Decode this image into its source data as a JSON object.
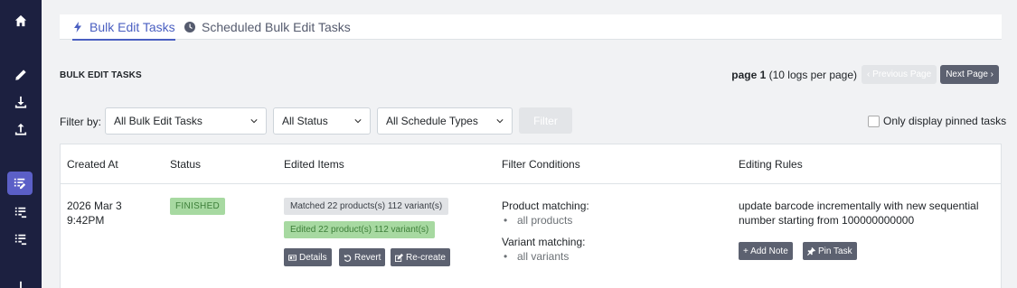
{
  "tabs": [
    {
      "label": "Bulk Edit Tasks",
      "active": true,
      "icon": "bolt-icon"
    },
    {
      "label": "Scheduled Bulk Edit Tasks",
      "active": false,
      "icon": "clock-icon"
    }
  ],
  "section_title": "BULK EDIT TASKS",
  "pager": {
    "page_label": "page 1",
    "per_page": "(10 logs per page)",
    "prev": "‹ Previous Page",
    "next": "Next Page ›"
  },
  "filters": {
    "label": "Filter by:",
    "task_type": "All Bulk Edit Tasks",
    "status": "All Status",
    "schedule": "All Schedule Types",
    "filter_button": "Filter",
    "pinned_label": "Only display pinned tasks"
  },
  "table": {
    "headers": [
      "Created At",
      "Status",
      "Edited Items",
      "Filter Conditions",
      "Editing Rules"
    ],
    "rows": [
      {
        "created_date": "2026 Mar 3",
        "created_time": "9:42PM",
        "status": "FINISHED",
        "matched": "Matched 22 products(s) 112 variant(s)",
        "edited": "Edited 22 product(s) 112 variant(s)",
        "actions": {
          "details": "Details",
          "revert": "Revert",
          "recreate": "Re-create"
        },
        "product_matching_label": "Product matching:",
        "product_matching_value": "all products",
        "variant_matching_label": "Variant matching:",
        "variant_matching_value": "all variants",
        "rule_line1": "update barcode incrementally with new sequential",
        "rule_line2": "number starting from 100000000000",
        "add_note": "+ Add Note",
        "pin_task": "Pin Task"
      }
    ]
  },
  "colors": {
    "sidebar": "#1c2040",
    "accent": "#4a5fc1",
    "button_dark": "#5c6170",
    "success_bg": "#a7d9a1"
  }
}
